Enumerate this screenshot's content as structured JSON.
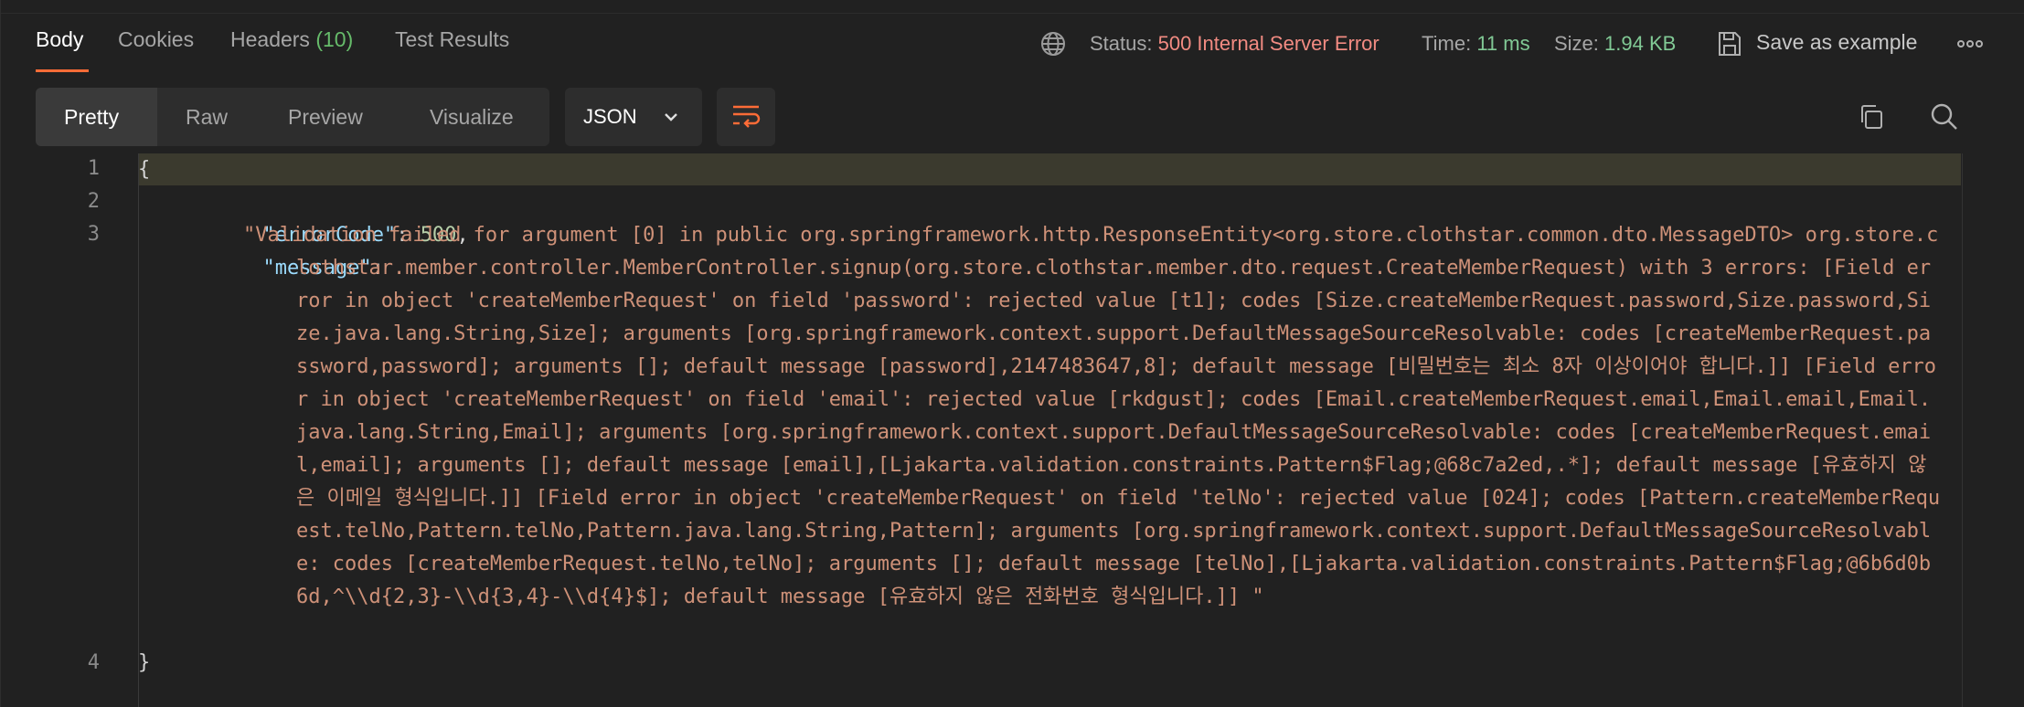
{
  "tabs": [
    {
      "label": "Body",
      "active": true
    },
    {
      "label": "Cookies"
    },
    {
      "label": "Headers",
      "count": "(10)"
    },
    {
      "label": "Test Results"
    }
  ],
  "status": {
    "label": "Status:",
    "value": "500 Internal Server Error",
    "time_label": "Time:",
    "time_value": "11 ms",
    "size_label": "Size:",
    "size_value": "1.94 KB"
  },
  "save_label": "Save as example",
  "modes": [
    "Pretty",
    "Raw",
    "Preview",
    "Visualize"
  ],
  "format": "JSON",
  "line_numbers": [
    "1",
    "2",
    "3",
    "4"
  ],
  "code": {
    "open_brace": "{",
    "close_brace": "}",
    "errorCode_key": "\"errorCode\"",
    "errorCode_value": "500",
    "message_key": "\"message\"",
    "message_value": "\"Validation failed for argument [0] in public org.springframework.http.ResponseEntity<org.store.clothstar.common.dto.MessageDTO> org.store.clothstar.member.controller.MemberController.signup(org.store.clothstar.member.dto.request.CreateMemberRequest) with 3 errors: [Field error in object 'createMemberRequest' on field 'password': rejected value [t1]; codes [Size.createMemberRequest.password,Size.password,Size.java.lang.String,Size]; arguments [org.springframework.context.support.DefaultMessageSourceResolvable: codes [createMemberRequest.password,password]; arguments []; default message [password],2147483647,8]; default message [비밀번호는 최소 8자 이상이어야 합니다.]] [Field error in object 'createMemberRequest' on field 'email': rejected value [rkdgust]; codes [Email.createMemberRequest.email,Email.email,Email.java.lang.String,Email]; arguments [org.springframework.context.support.DefaultMessageSourceResolvable: codes [createMemberRequest.email,email]; arguments []; default message [email],[Ljakarta.validation.constraints.Pattern$Flag;@68c7a2ed,.*]; default message [유효하지 않은 이메일 형식입니다.]] [Field error in object 'createMemberRequest' on field 'telNo': rejected value [024]; codes [Pattern.createMemberRequest.telNo,Pattern.telNo,Pattern.java.lang.String,Pattern]; arguments [org.springframework.context.support.DefaultMessageSourceResolvable: codes [createMemberRequest.telNo,telNo]; arguments []; default message [telNo],[Ljakarta.validation.constraints.Pattern$Flag;@6b6d0b6d,^\\\\d{2,3}-\\\\d{3,4}-\\\\d{4}$]; default message [유효하지 않은 전화번호 형식입니다.]] \""
  },
  "icons": {
    "globe": "globe-icon",
    "save": "save-icon",
    "more": "more-icon",
    "wrap": "wrap-lines-icon",
    "copy": "copy-icon",
    "search": "search-icon",
    "chevron": "chevron-down-icon"
  },
  "colors": {
    "accent": "#ff6c37",
    "error": "#f28b82",
    "success": "#81c995",
    "string": "#ce9178",
    "key": "#9cdcfe"
  }
}
